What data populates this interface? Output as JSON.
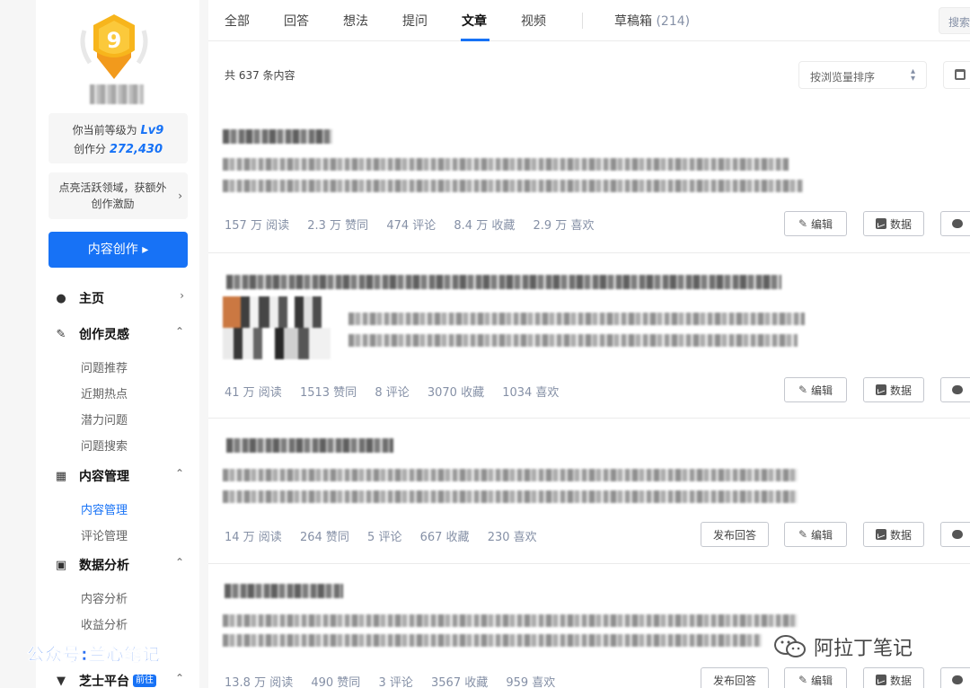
{
  "sidebar": {
    "medal_level": "9",
    "level_prefix": "你当前等级为",
    "level_value": "Lv9",
    "score_prefix": "创作分",
    "score_value": "272,430",
    "promo_text": "点亮活跃领域，获额外创作激励",
    "create_button": "内容创作 ▸",
    "nav": {
      "home": "主页",
      "inspiration": "创作灵感",
      "inspiration_items": [
        "问题推荐",
        "近期热点",
        "潜力问题",
        "问题搜索"
      ],
      "content_mgmt": "内容管理",
      "content_items": [
        "内容管理",
        "评论管理"
      ],
      "data_analysis": "数据分析",
      "data_items": [
        "内容分析",
        "收益分析"
      ],
      "zhishi": "芝士平台",
      "zhishi_badge": "前往"
    }
  },
  "tabs": [
    "全部",
    "回答",
    "想法",
    "提问",
    "文章",
    "视频"
  ],
  "active_tab": "文章",
  "drafts_label": "草稿箱",
  "drafts_count": "(214)",
  "search_placeholder": "搜索",
  "total_text": "共 637 条内容",
  "sort_label": "按浏览量排序",
  "articles": [
    {
      "stats": [
        "157 万 阅读",
        "2.3 万 赞同",
        "474 评论",
        "8.4 万 收藏",
        "2.9 万 喜欢"
      ]
    },
    {
      "stats": [
        "41 万 阅读",
        "1513 赞同",
        "8 评论",
        "3070 收藏",
        "1034 喜欢"
      ]
    },
    {
      "stats": [
        "14 万 阅读",
        "264 赞同",
        "5 评论",
        "667 收藏",
        "230 喜欢"
      ]
    },
    {
      "stats": [
        "13.8 万 阅读",
        "490 赞同",
        "3 评论",
        "3567 收藏",
        "959 喜欢"
      ]
    }
  ],
  "buttons": {
    "publish_answer": "发布回答",
    "edit": "编辑",
    "data": "数据"
  },
  "watermark_left": "公众号:兰心笔记",
  "watermark_right": "阿拉丁笔记",
  "colors": {
    "accent": "#1772f6",
    "muted": "#8590a6"
  }
}
